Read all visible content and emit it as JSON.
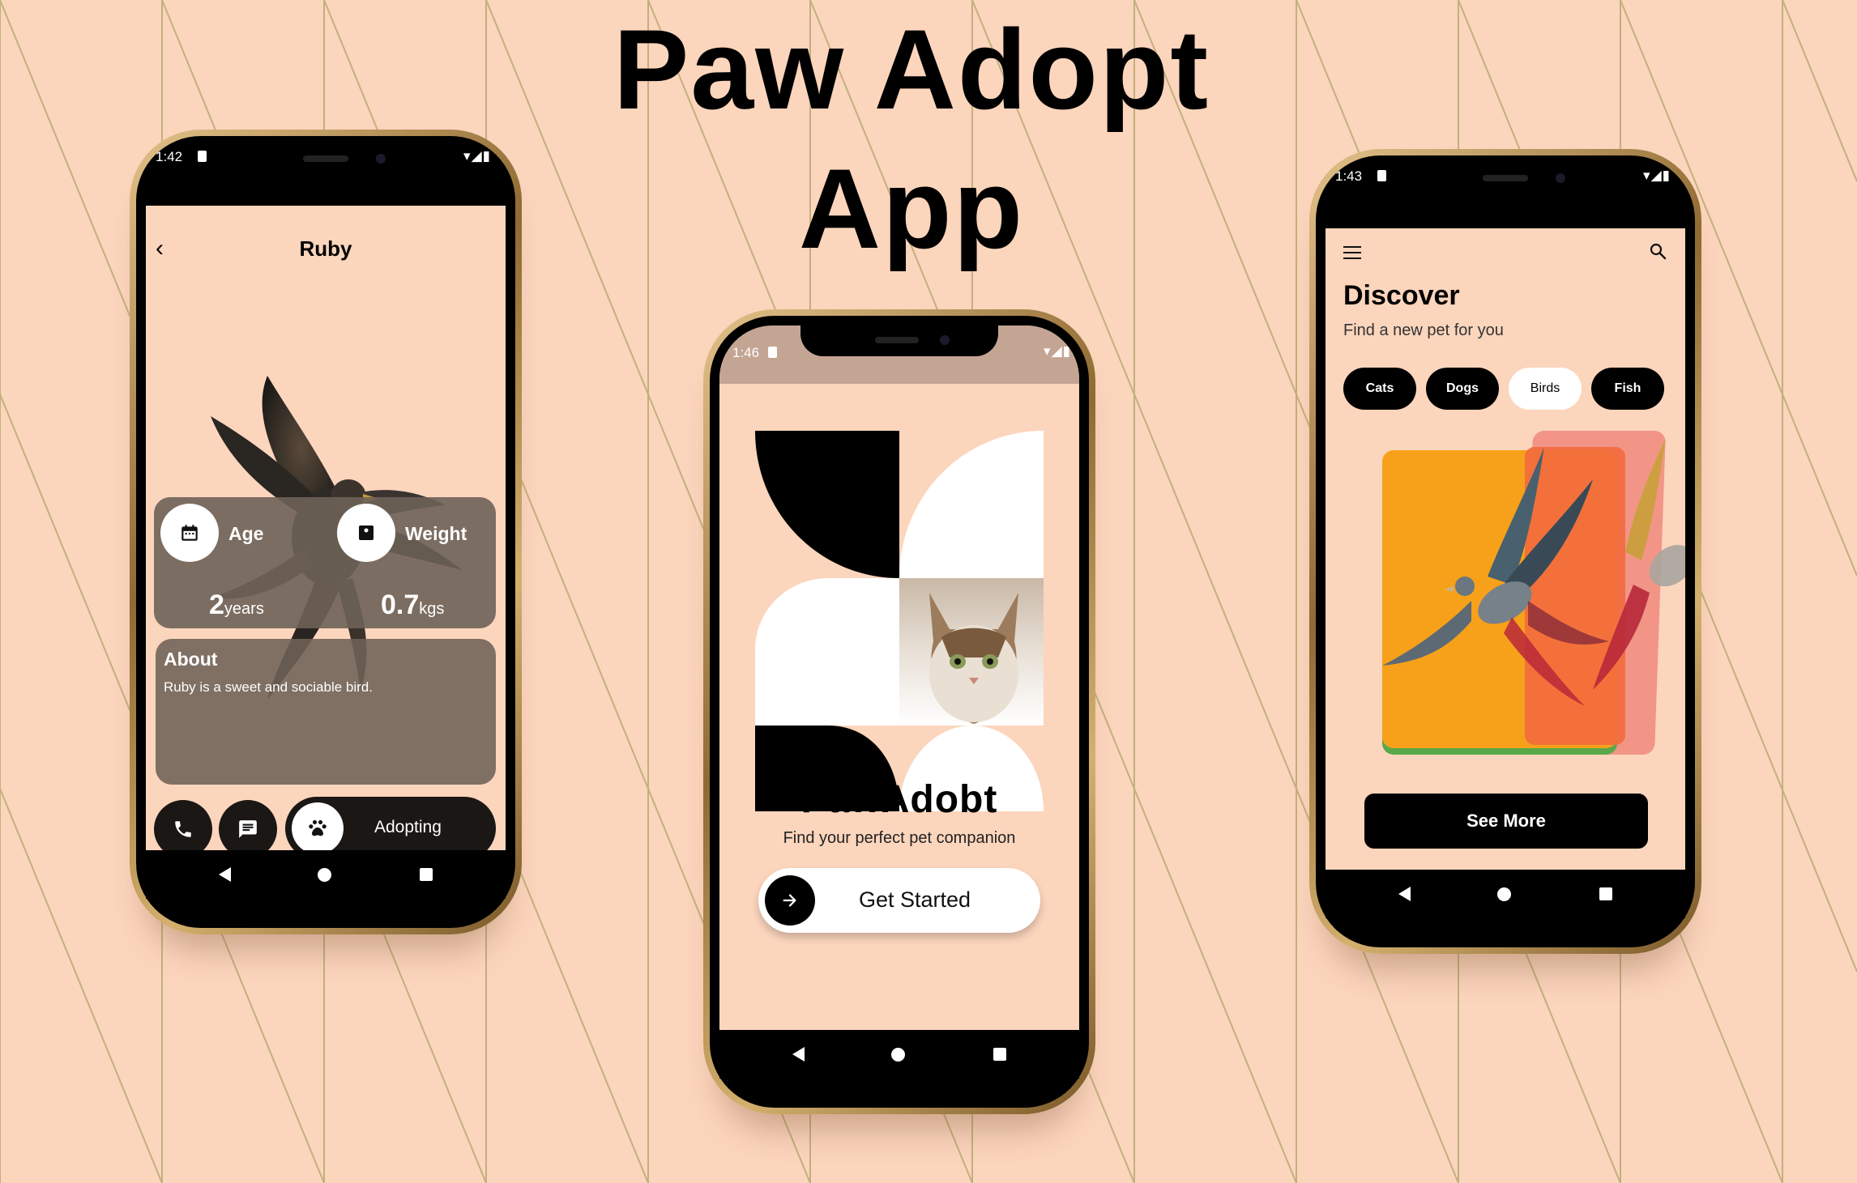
{
  "headline": {
    "line1": "Paw Adopt",
    "line2": "App"
  },
  "phone_detail": {
    "status_time": "1:42",
    "title": "Ruby",
    "age_label": "Age",
    "age_value": "2",
    "age_unit": "years",
    "weight_label": "Weight",
    "weight_value": "0.7",
    "weight_unit": "kgs",
    "about_title": "About",
    "about_text": "Ruby is a sweet and sociable bird.",
    "adopt_label": "Adopting"
  },
  "phone_welcome": {
    "status_time": "1:46",
    "brand": "PawAdobt",
    "tagline": "Find your perfect pet companion",
    "cta_label": "Get Started"
  },
  "phone_discover": {
    "status_time": "1:43",
    "title": "Discover",
    "subtitle": "Find a new pet for you",
    "categories": [
      "Cats",
      "Dogs",
      "Birds",
      "Fish"
    ],
    "active_category": "Birds",
    "see_more_label": "See More"
  },
  "colors": {
    "background": "#fcd5bd",
    "card_overlay": "#6e6258",
    "accent_dark": "#000000",
    "card_orange": "#f7a11a",
    "card_red": "#f26a3e"
  }
}
